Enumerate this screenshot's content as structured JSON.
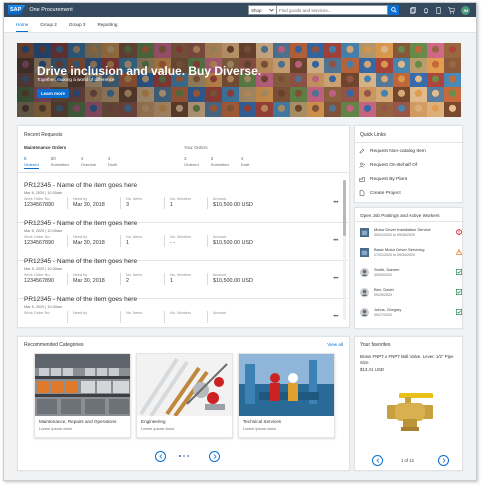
{
  "shell": {
    "logo": "SAP",
    "app_name": "One Procurement",
    "search_scope": "Shop",
    "search_placeholder": "Find goods and services...",
    "avatar_initials": "JM"
  },
  "tabs": [
    {
      "label": "Home"
    },
    {
      "label": "Group 2"
    },
    {
      "label": "Group 3"
    },
    {
      "label": "Reporting"
    }
  ],
  "hero": {
    "title": "Drive inclusion and value. Buy Diverse.",
    "subtitle": "Together, making a world of difference",
    "button": "Learn more"
  },
  "recent_requests": {
    "title": "Recent Requests",
    "maintenance_label": "Maintenance Orders",
    "your_orders_label": "Your Orders",
    "maintenance_stats": [
      {
        "num": "5",
        "label": "Ordered"
      },
      {
        "num": "50",
        "label": "Submitted"
      },
      {
        "num": "4",
        "label": "Overdue"
      },
      {
        "num": "4",
        "label": "Draft"
      }
    ],
    "order_stats": [
      {
        "num": "3",
        "label": "Ordered"
      },
      {
        "num": "3",
        "label": "Submitted"
      },
      {
        "num": "4",
        "label": "Draft"
      }
    ],
    "field_labels": {
      "work_order": "Work Order No.",
      "need_by": "Need by",
      "no_items": "No. Items",
      "no_workers": "No. Workers",
      "amount": "Amount"
    },
    "items": [
      {
        "title": "PR12345 - Name of the item goes here",
        "date": "Mar 8, 2020 | 10:30am",
        "work_order": "1234567890",
        "need_by": "Mar 30, 2018",
        "no_items": "3",
        "no_workers": "1",
        "amount": "$10,500.00 USD"
      },
      {
        "title": "PR12345 - Name of the item goes here",
        "date": "Mar 8, 2020 | 10:30am",
        "work_order": "1234567890",
        "need_by": "Mar 30, 2018",
        "no_items": "1",
        "no_workers": "- -",
        "amount": "$10,500.00 USD"
      },
      {
        "title": "PR12345 - Name of the item goes here",
        "date": "Mar 8, 2020 | 10:30am",
        "work_order": "1234567890",
        "need_by": "Mar 30, 2018",
        "no_items": "2",
        "no_workers": "1",
        "amount": "$10,500.00 USD"
      },
      {
        "title": "PR12345 - Name of the item goes here",
        "date": "Mar 8, 2020 | 10:30am",
        "work_order": "",
        "need_by": "",
        "no_items": "",
        "no_workers": "",
        "amount": ""
      }
    ]
  },
  "quick_links": {
    "title": "Quick Links",
    "items": [
      {
        "label": "Request Non-catalog Item",
        "icon": "edit-icon"
      },
      {
        "label": "Request On-Behalf Of",
        "icon": "person-request-icon"
      },
      {
        "label": "Request By Plant",
        "icon": "plant-icon"
      },
      {
        "label": "Create Project",
        "icon": "document-icon"
      }
    ]
  },
  "jobs": {
    "title": "Open Job Postings and Active Workers",
    "items": [
      {
        "title": "Motor Driver Installation Service",
        "sub": "30/01/2020 to 09/30/2020",
        "status": "error",
        "thumb": "job"
      },
      {
        "title": "Basic Motor Driver Servicing",
        "sub": "27/01/2020 to 09/30/2020",
        "status": "warning",
        "thumb": "job"
      },
      {
        "title": "Smith, Damen",
        "sub": "30/09/2020",
        "status": "success",
        "thumb": "person"
      },
      {
        "title": "Ben, David",
        "sub": "09/29/2020",
        "status": "success",
        "thumb": "person"
      },
      {
        "title": "Johns, Gregory",
        "sub": "09/27/2020",
        "status": "success",
        "thumb": "person"
      }
    ]
  },
  "categories": {
    "title": "Recommended Categories",
    "view_all": "View all",
    "items": [
      {
        "name": "Maintenance, Repairs and Operations",
        "desc": "Lorem ipsum dolor"
      },
      {
        "name": "Engineering",
        "desc": "Lorem ipsum dolor"
      },
      {
        "name": "Technical Services",
        "desc": "Lorem ipsum dolor"
      }
    ],
    "dots": 3,
    "active_dot": 1
  },
  "favorites": {
    "title": "Your favorites",
    "item_name": "Brass FNPT x FNPT Ball Valve, Lever, 1/2\" Pipe Size",
    "item_price": "$13.41 USD",
    "pager": "1 of 13"
  },
  "colors": {
    "shell": "#354a5f",
    "accent": "#0a6ed1",
    "error": "#bb0000",
    "warning": "#e9730c",
    "success": "#107e3e"
  }
}
